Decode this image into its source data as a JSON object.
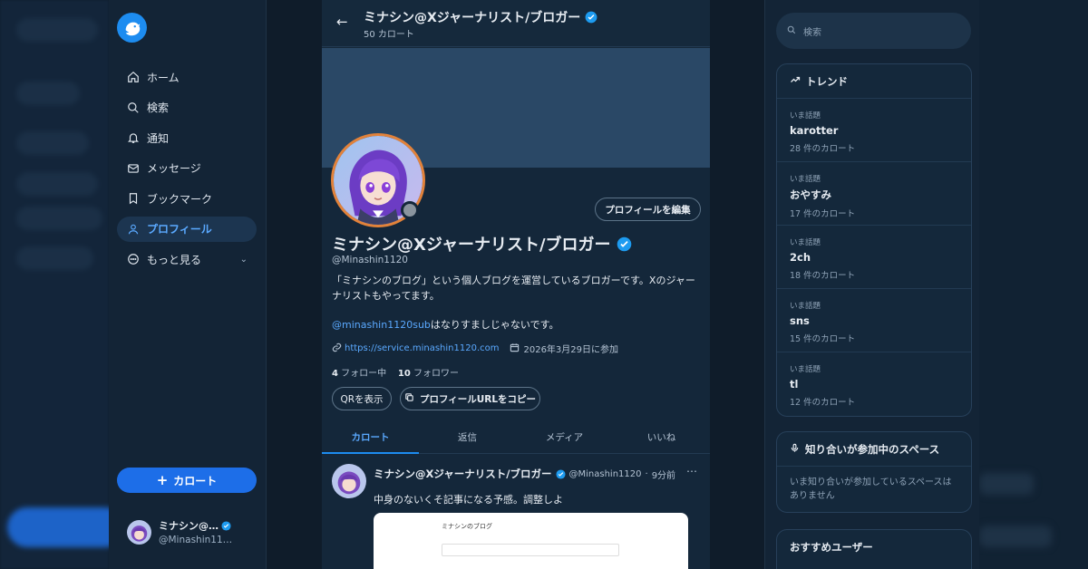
{
  "sidebar": {
    "logo_icon": "app-logo-icon",
    "nav": [
      {
        "label": "ホーム",
        "icon": "home-icon"
      },
      {
        "label": "検索",
        "icon": "search-icon"
      },
      {
        "label": "通知",
        "icon": "bell-icon"
      },
      {
        "label": "メッセージ",
        "icon": "mail-icon"
      },
      {
        "label": "ブックマーク",
        "icon": "bookmark-icon"
      },
      {
        "label": "プロフィール",
        "icon": "user-icon",
        "active": true
      },
      {
        "label": "もっと見る",
        "icon": "more-icon"
      }
    ],
    "post_button": "カロート",
    "account": {
      "name": "ミナシン@…",
      "handle": "@Minashin11…"
    }
  },
  "header": {
    "title": "ミナシン@Xジャーナリスト/ブロガー",
    "subtitle": "50 カロート"
  },
  "profile": {
    "edit_button": "プロフィールを編集",
    "name": "ミナシン@Xジャーナリスト/ブロガー",
    "handle": "@Minashin1120",
    "bio_line": "「ミナシンのブログ」という個人ブログを運営しているブロガーです。Xのジャーナリストもやってます。",
    "bio_mention": "@minashin1120sub",
    "bio_mention_rest": "はなりすましじゃないです。",
    "url": "https://service.minashin1120.com",
    "joined": "2026年3月29日に参加",
    "following_count": "4",
    "following_label": "フォロー中",
    "followers_count": "10",
    "followers_label": "フォロワー",
    "qr_button": "QRを表示",
    "copy_button": "プロフィールURLをコピー"
  },
  "tabs": [
    "カロート",
    "返信",
    "メディア",
    "いいね"
  ],
  "post": {
    "name": "ミナシン@Xジャーナリスト/ブロガー",
    "handle": "@Minashin1120",
    "time": "9分前",
    "text": "中身のないくそ記事になる予感。調整しよ",
    "thumb_title": "ミナシンのブログ"
  },
  "right": {
    "search_placeholder": "検索",
    "trends_title": "トレンド",
    "trends": [
      {
        "label": "いま話題",
        "title": "karotter",
        "count": "28 件のカロート"
      },
      {
        "label": "いま話題",
        "title": "おやすみ",
        "count": "17 件のカロート"
      },
      {
        "label": "いま話題",
        "title": "2ch",
        "count": "18 件のカロート"
      },
      {
        "label": "いま話題",
        "title": "sns",
        "count": "15 件のカロート"
      },
      {
        "label": "いま話題",
        "title": "tl",
        "count": "12 件のカロート"
      }
    ],
    "spaces_title": "知り合いが参加中のスペース",
    "spaces_body": "いま知り合いが参加しているスペースはありません",
    "recommend_title": "おすすめユーザー"
  },
  "colors": {
    "accent": "#1d8cf0",
    "link": "#5aa9ff",
    "verified": "#1d9bf0",
    "avatar_ring": "#e2823a"
  }
}
